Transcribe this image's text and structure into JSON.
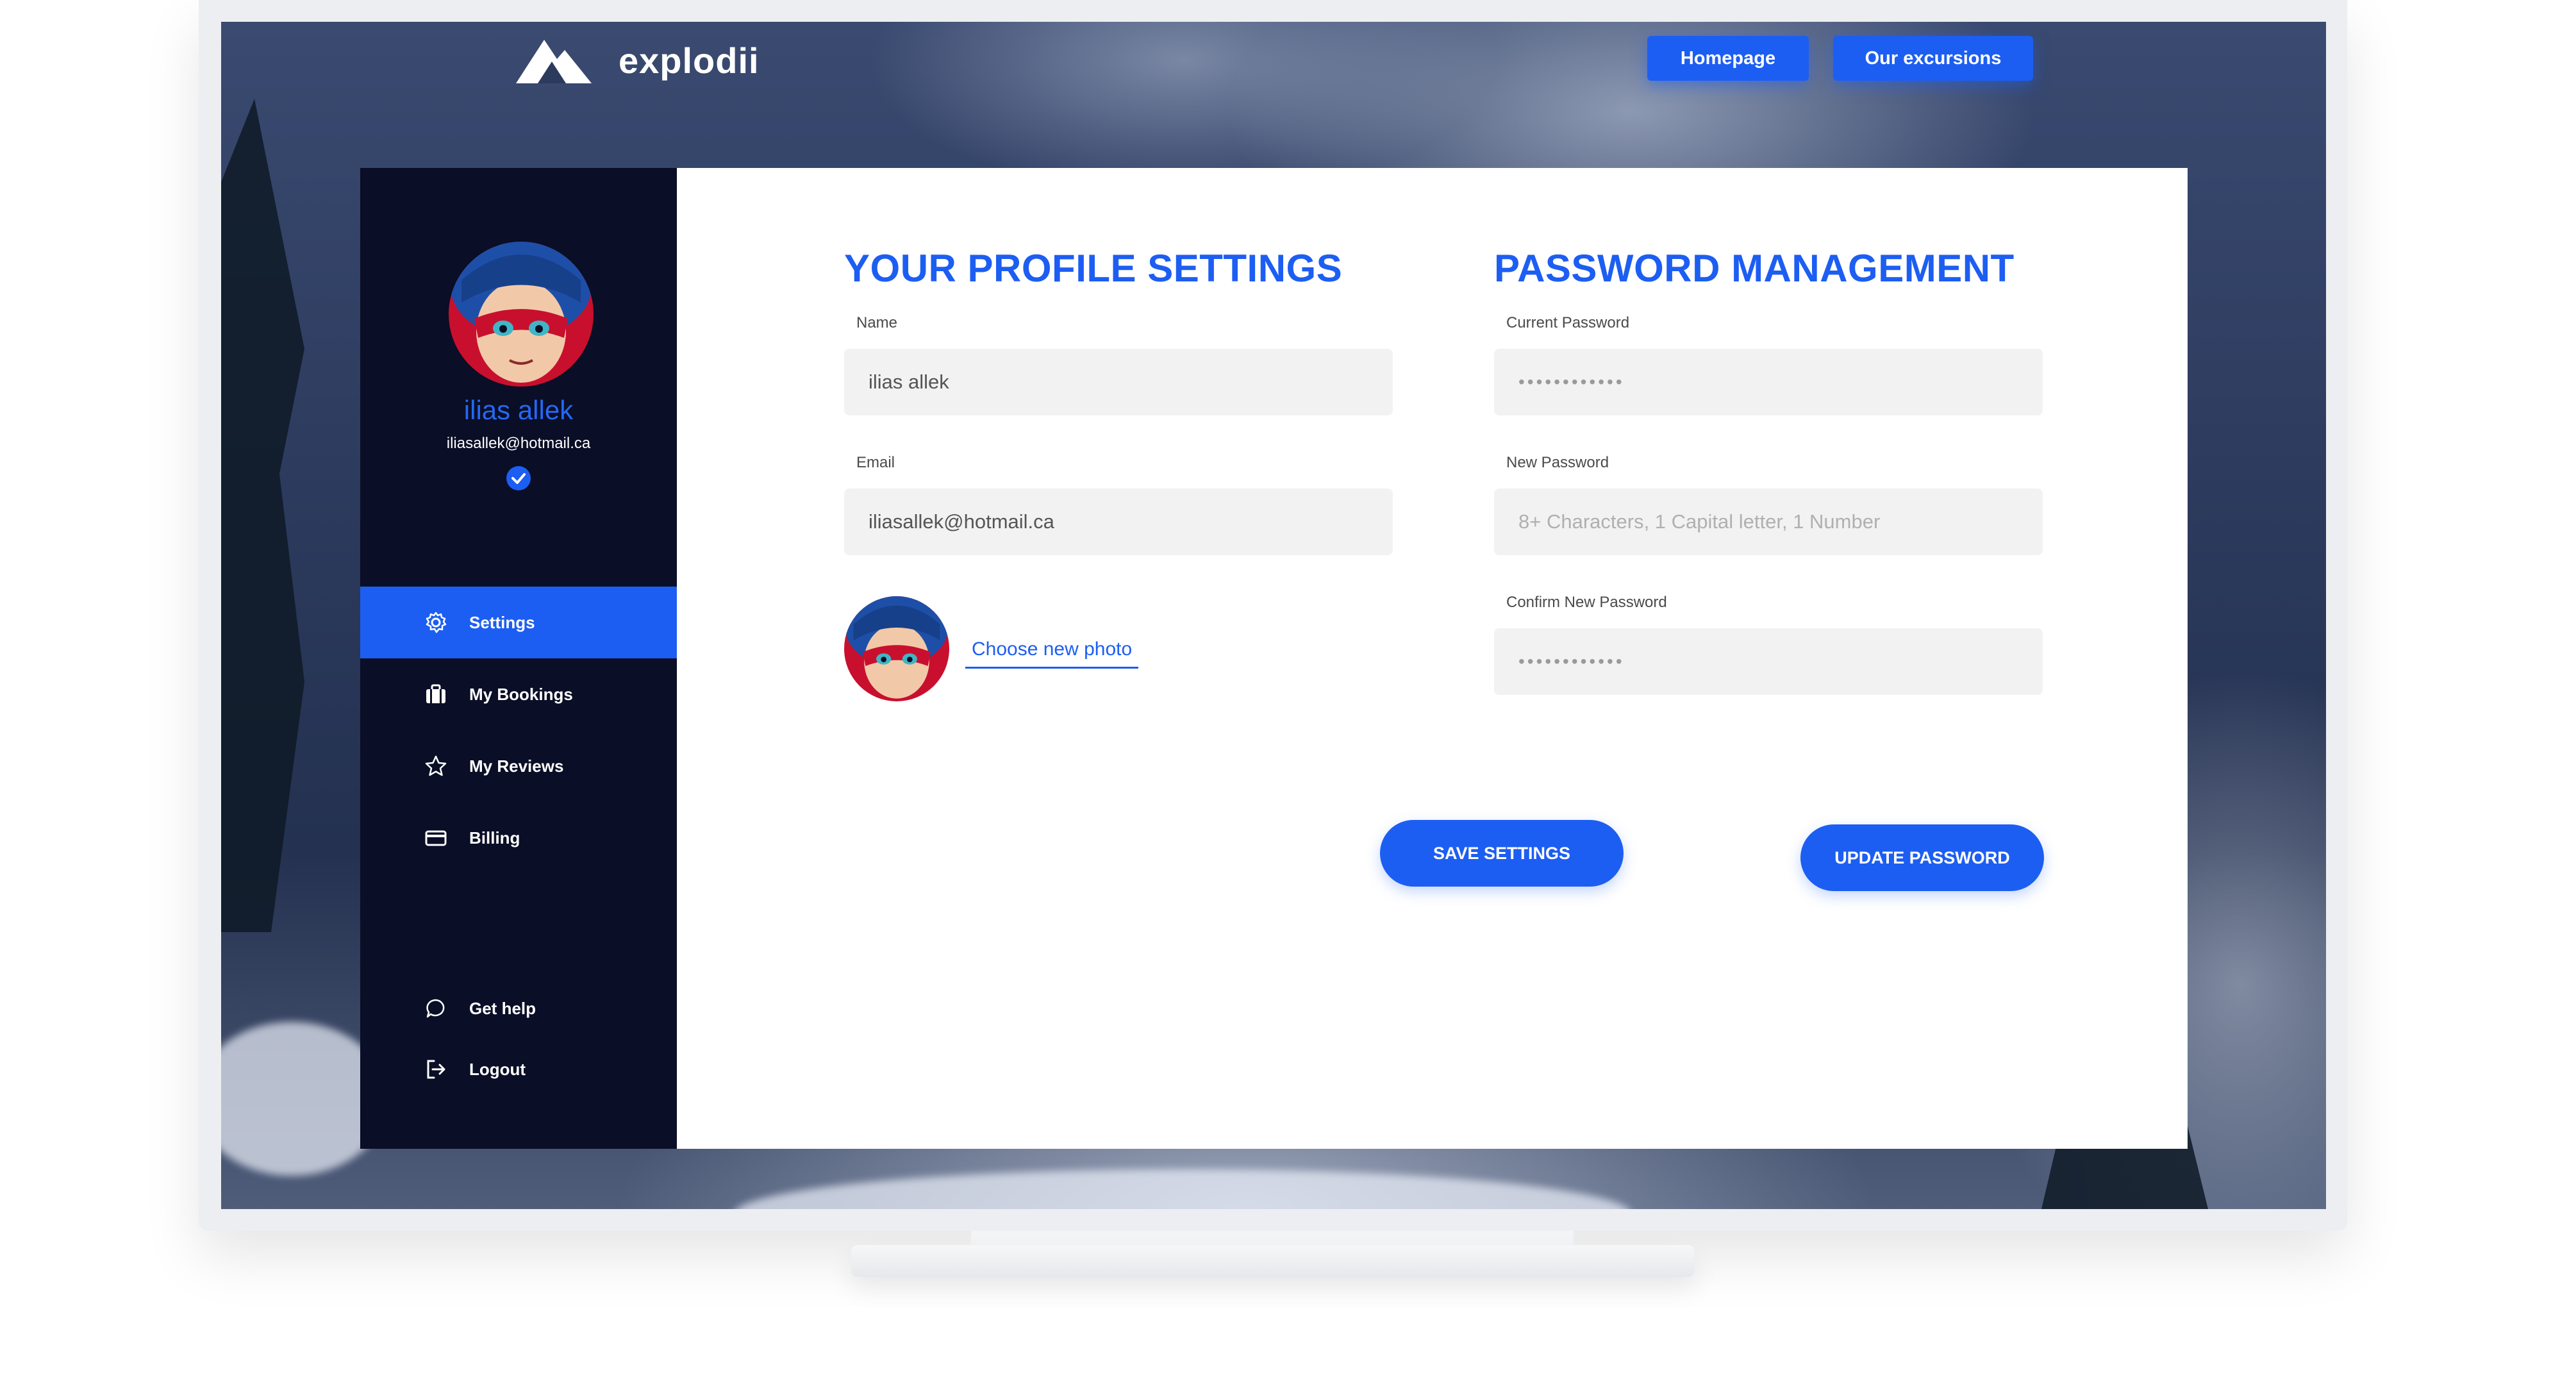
{
  "app": {
    "brand_name": "explodii"
  },
  "topnav": {
    "homepage_label": "Homepage",
    "excursions_label": "Our excursions"
  },
  "user": {
    "name": "ilias allek",
    "email": "iliasallek@hotmail.ca"
  },
  "sidebar": {
    "items": [
      {
        "label": "Settings",
        "icon": "gear-icon",
        "active": true
      },
      {
        "label": "My Bookings",
        "icon": "briefcase-icon",
        "active": false
      },
      {
        "label": "My Reviews",
        "icon": "star-icon",
        "active": false
      },
      {
        "label": "Billing",
        "icon": "credit-card-icon",
        "active": false
      }
    ],
    "footer_items": [
      {
        "label": "Get help",
        "icon": "chat-bubble-icon"
      },
      {
        "label": "Logout",
        "icon": "logout-icon"
      }
    ]
  },
  "profile": {
    "title": "YOUR PROFILE SETTINGS",
    "name_label": "Name",
    "name_value": "ilias allek",
    "email_label": "Email",
    "email_value": "iliasallek@hotmail.ca",
    "choose_photo_label": "Choose new photo",
    "save_label": "SAVE SETTINGS"
  },
  "password": {
    "title": "PASSWORD MANAGEMENT",
    "current_label": "Current Password",
    "current_value": "••••••••••••",
    "new_label": "New Password",
    "new_placeholder": "8+ Characters, 1 Capital letter, 1 Number",
    "confirm_label": "Confirm New Password",
    "confirm_value": "••••••••••••",
    "update_label": "UPDATE PASSWORD"
  },
  "colors": {
    "accent": "#1d5ef2",
    "sidebar_bg": "#0a0e26",
    "field_bg": "#f2f2f2"
  }
}
